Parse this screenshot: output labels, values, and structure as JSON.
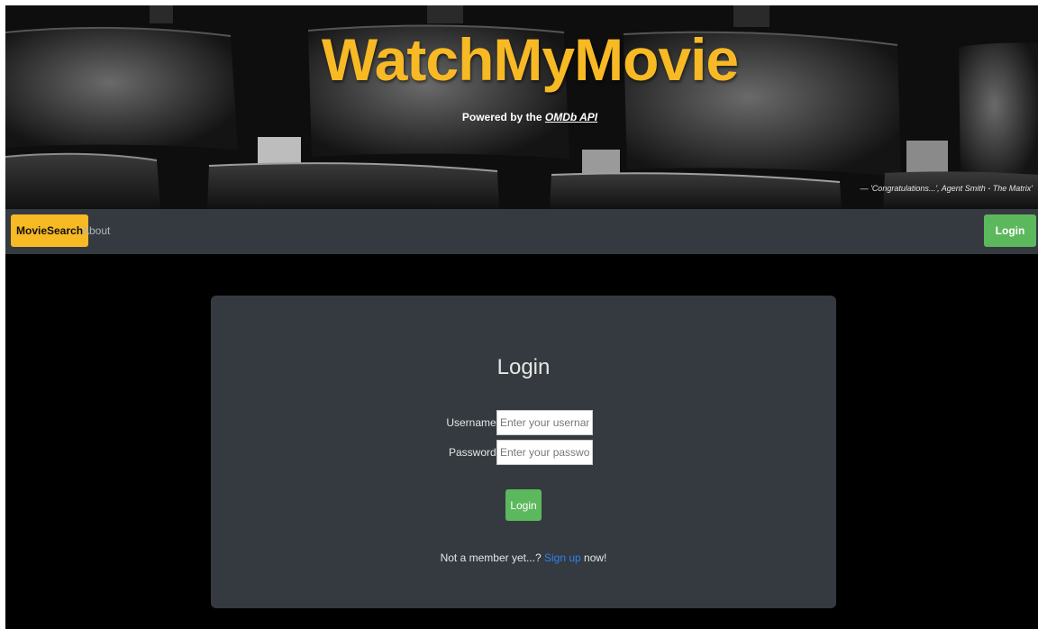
{
  "hero": {
    "title": "WatchMyMovie",
    "subtitle_prefix": "Powered by the ",
    "subtitle_link": "OMDb API",
    "quote": "— 'Congratulations...', Agent Smith - The Matrix'"
  },
  "navbar": {
    "brand": "MovieSearch",
    "about": "About",
    "login": "Login"
  },
  "login_card": {
    "title": "Login",
    "username_label": "Username:",
    "username_placeholder": "Enter your username",
    "password_label": "Password:",
    "password_placeholder": "Enter your password",
    "submit": "Login",
    "signup_prefix": "Not a member yet...?",
    "signup_link": "Sign up",
    "signup_suffix": "now!"
  },
  "colors": {
    "brand_yellow": "#f7b924",
    "navbar_bg": "#343a40",
    "success_green": "#5cb85c",
    "link_blue": "#2f80ed"
  }
}
